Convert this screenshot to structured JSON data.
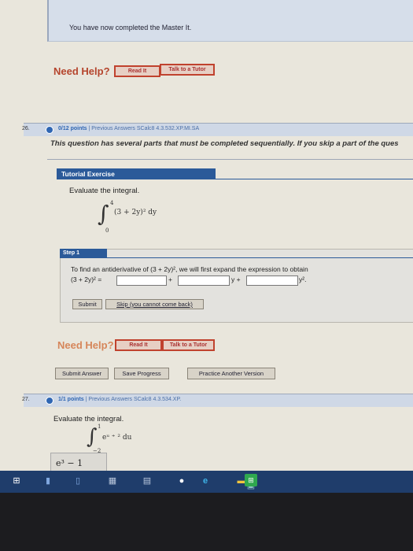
{
  "banner": {
    "completed_text": "You have now completed the Master It."
  },
  "help1": {
    "label": "Need Help?",
    "read_it": "Read It",
    "talk_tutor": "Talk to a Tutor"
  },
  "q26": {
    "number": "26.",
    "points": "0/12 points",
    "meta": "| Previous Answers  SCalc8 4.3.532.XP.MI.SA",
    "note": "This question has several parts that must be completed sequentially. If you skip a part of the ques",
    "tutorial_label": "Tutorial Exercise",
    "evaluate": "Evaluate the integral.",
    "integral": {
      "upper": "4",
      "lower": "0",
      "expr": "(3 + 2y)² dy"
    },
    "step": {
      "label": "Step 1",
      "line1": "To find an antiderivative of (3 + 2y)², we will first expand the expression to obtain",
      "line2_prefix": "(3 + 2y)² =",
      "plus1": "+",
      "y_plus": "y +",
      "y2": "y².",
      "submit": "Submit",
      "skip": "Skip (you cannot come back)"
    },
    "help": {
      "label": "Need Help?",
      "read_it": "Read It",
      "talk_tutor": "Talk to a Tutor"
    },
    "actions": {
      "submit_answer": "Submit Answer",
      "save_progress": "Save Progress",
      "practice": "Practice Another Version"
    }
  },
  "q27": {
    "number": "27.",
    "points": "1/1 points",
    "meta": "| Previous Answers  SCalc8 4.3.534.XP.",
    "evaluate": "Evaluate the integral.",
    "integral": {
      "upper": "1",
      "lower": "−2",
      "expr": "eᵘ ⁺ ² du"
    },
    "answer": "e³ − 1"
  },
  "colors": {
    "link_blue": "#2f66b3",
    "header_blue": "#2b5a99",
    "help_red": "#b5452d",
    "taskbar": "#1f3d6b"
  }
}
